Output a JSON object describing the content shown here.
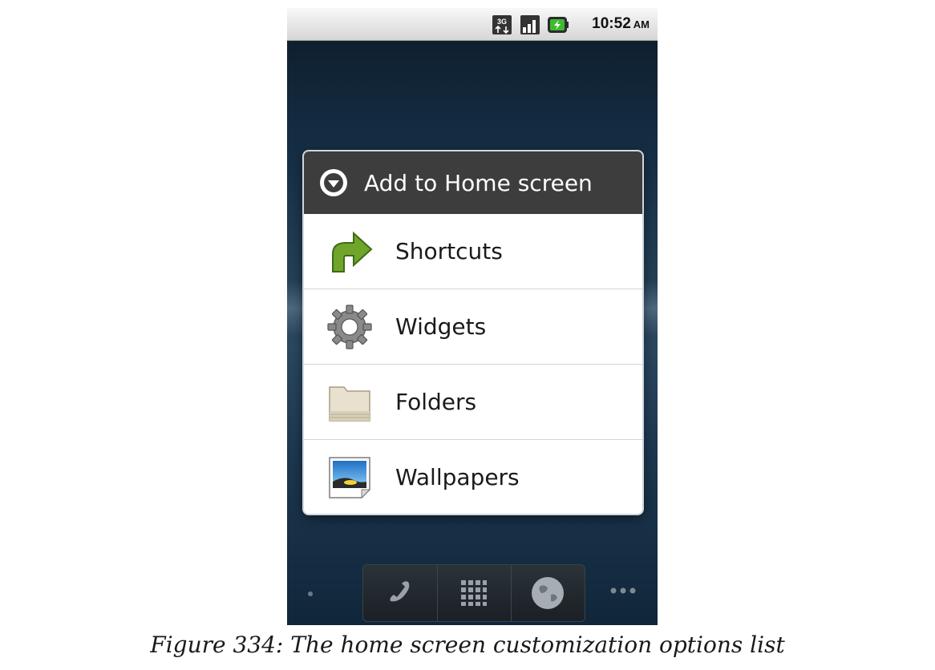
{
  "status_bar": {
    "time": "10:52",
    "ampm": "AM",
    "icons": [
      "3g-data-icon",
      "signal-strength-icon",
      "battery-charging-icon"
    ]
  },
  "dialog": {
    "title": "Add to Home screen",
    "title_icon": "chevron-down-circle-icon",
    "items": [
      {
        "label": "Shortcuts",
        "icon": "shortcut-arrow-icon"
      },
      {
        "label": "Widgets",
        "icon": "gear-icon"
      },
      {
        "label": "Folders",
        "icon": "folder-icon"
      },
      {
        "label": "Wallpapers",
        "icon": "wallpaper-picture-icon"
      }
    ]
  },
  "dock": {
    "buttons": [
      "phone-icon",
      "app-grid-icon",
      "browser-globe-icon"
    ]
  },
  "caption": "Figure 334: The home screen customization options list",
  "colors": {
    "dialog_header": "#3d3d3d",
    "shortcut_green": "#6fa52a",
    "wallpaper_blue": "#3a8fd8"
  }
}
